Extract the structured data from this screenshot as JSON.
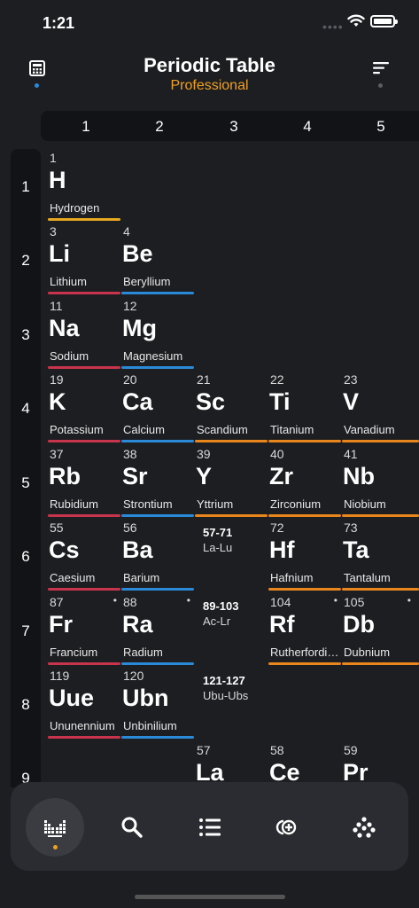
{
  "status": {
    "time": "1:21"
  },
  "header": {
    "title": "Periodic Table",
    "subtitle": "Professional"
  },
  "colors": {
    "accent": "#f0a020",
    "alkali": "#c8344c",
    "alkaline": "#2a8ad8",
    "transition": "#e8861c",
    "hydrogen": "#e8a820"
  },
  "columns": [
    "1",
    "2",
    "3",
    "4",
    "5"
  ],
  "rows": [
    "1",
    "2",
    "3",
    "4",
    "5",
    "6",
    "7",
    "8",
    "9"
  ],
  "elements": [
    {
      "num": "1",
      "sym": "H",
      "name": "Hydrogen"
    },
    {
      "num": "3",
      "sym": "Li",
      "name": "Lithium"
    },
    {
      "num": "4",
      "sym": "Be",
      "name": "Beryllium"
    },
    {
      "num": "11",
      "sym": "Na",
      "name": "Sodium"
    },
    {
      "num": "12",
      "sym": "Mg",
      "name": "Magnesium"
    },
    {
      "num": "19",
      "sym": "K",
      "name": "Potassium"
    },
    {
      "num": "20",
      "sym": "Ca",
      "name": "Calcium"
    },
    {
      "num": "21",
      "sym": "Sc",
      "name": "Scandium"
    },
    {
      "num": "22",
      "sym": "Ti",
      "name": "Titanium"
    },
    {
      "num": "23",
      "sym": "V",
      "name": "Vanadium"
    },
    {
      "num": "37",
      "sym": "Rb",
      "name": "Rubidium"
    },
    {
      "num": "38",
      "sym": "Sr",
      "name": "Strontium"
    },
    {
      "num": "39",
      "sym": "Y",
      "name": "Yttrium"
    },
    {
      "num": "40",
      "sym": "Zr",
      "name": "Zirconium"
    },
    {
      "num": "41",
      "sym": "Nb",
      "name": "Niobium"
    },
    {
      "num": "55",
      "sym": "Cs",
      "name": "Caesium"
    },
    {
      "num": "56",
      "sym": "Ba",
      "name": "Barium"
    },
    {
      "num": "72",
      "sym": "Hf",
      "name": "Hafnium"
    },
    {
      "num": "73",
      "sym": "Ta",
      "name": "Tantalum"
    },
    {
      "num": "87",
      "sym": "Fr",
      "name": "Francium"
    },
    {
      "num": "88",
      "sym": "Ra",
      "name": "Radium"
    },
    {
      "num": "104",
      "sym": "Rf",
      "name": "Rutherfordium"
    },
    {
      "num": "105",
      "sym": "Db",
      "name": "Dubnium"
    },
    {
      "num": "119",
      "sym": "Uue",
      "name": "Ununennium"
    },
    {
      "num": "120",
      "sym": "Ubn",
      "name": "Unbinilium"
    },
    {
      "num": "57",
      "sym": "La",
      "name": ""
    },
    {
      "num": "58",
      "sym": "Ce",
      "name": ""
    },
    {
      "num": "59",
      "sym": "Pr",
      "name": ""
    }
  ],
  "ranges": [
    {
      "range": "57-71",
      "label": "La-Lu"
    },
    {
      "range": "89-103",
      "label": "Ac-Lr"
    },
    {
      "range": "121-127",
      "label": "Ubu-Ubs"
    }
  ],
  "tabs": [
    {
      "icon": "periodic-table-icon"
    },
    {
      "icon": "search-icon"
    },
    {
      "icon": "list-icon"
    },
    {
      "icon": "add-compound-icon"
    },
    {
      "icon": "molecule-dots-icon"
    }
  ]
}
